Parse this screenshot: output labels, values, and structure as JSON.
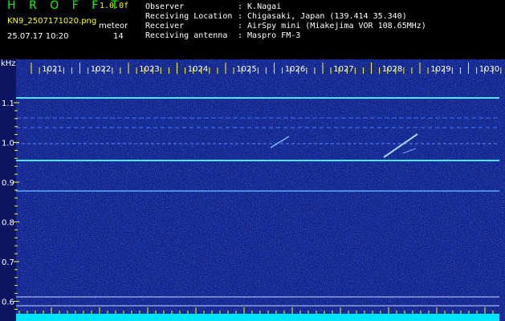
{
  "header": {
    "app_title": "H R O F F T",
    "version": "1.0.0f",
    "filename": "KN9_2507171020.png",
    "mode": "meteor",
    "datetime": "25.07.17 10:20",
    "count": "14",
    "meta": [
      {
        "label": "Observer",
        "value": ": K.Nagai"
      },
      {
        "label": "Receiving Location",
        "value": ": Chigasaki, Japan (139.414 35.340)"
      },
      {
        "label": "Receiver",
        "value": ": AirSpy mini (Miakejima VOR 108.65MHz)"
      },
      {
        "label": "Receiving antenna",
        "value": ": Maspro FM-3"
      }
    ]
  },
  "axes": {
    "y_unit": "kHz",
    "y_ticks": [
      "1.1",
      "1.0",
      "0.9",
      "0.8",
      "0.7",
      "0.6"
    ],
    "x_ticks": [
      "1021",
      "1022",
      "1023",
      "1024",
      "1025",
      "1026",
      "1027",
      "1028",
      "1029",
      "1030"
    ]
  },
  "colors": {
    "background": "#000000",
    "noise_base": "#0a1a7a",
    "tick_yellow": "#ffff00",
    "band_cyan": "#00e5ff"
  }
}
